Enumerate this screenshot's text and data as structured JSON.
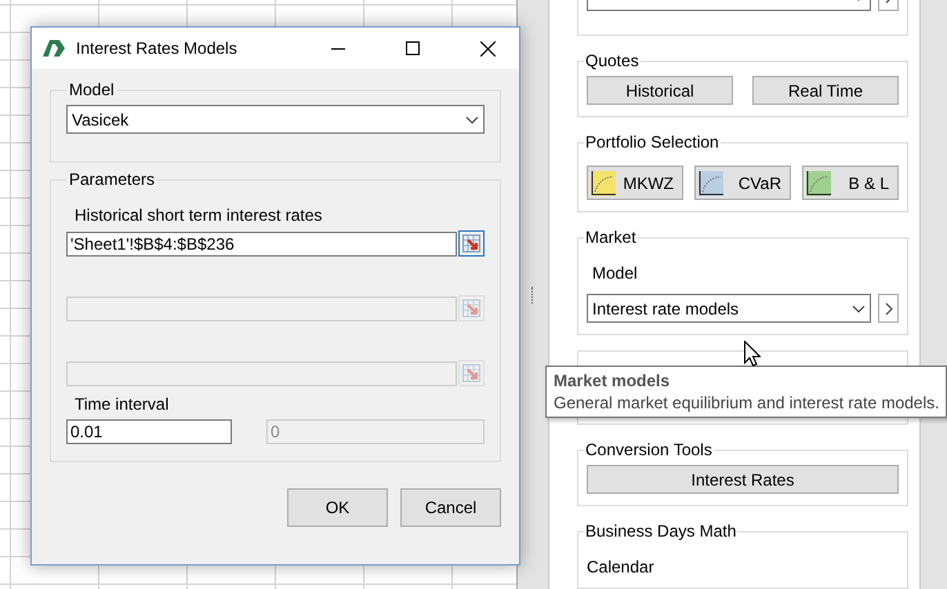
{
  "dialog": {
    "title": "Interest Rates Models",
    "model_group": {
      "label": "Model",
      "value": "Vasicek"
    },
    "parameters_group": {
      "label": "Parameters",
      "range_fields": [
        {
          "label": "Historical short term interest rates",
          "value": "'Sheet1'!$B$4:$B$236",
          "disabled": false
        },
        {
          "disabled": true
        },
        {
          "disabled": true
        }
      ],
      "time_interval": {
        "label": "Time interval",
        "value": "0.01",
        "extra_value": "0"
      }
    },
    "buttons": [
      "OK",
      "Cancel"
    ]
  },
  "panel": {
    "groups": [
      {
        "kind": "combo"
      },
      {
        "kind": "buttons",
        "label": "Quotes",
        "buttons": [
          "Historical",
          "Real Time"
        ]
      },
      {
        "kind": "chart-buttons",
        "label": "Portfolio Selection",
        "buttons": [
          {
            "label": "MKWZ",
            "color": "#f3e36a"
          },
          {
            "label": "CVaR",
            "color": "#b9cde3"
          },
          {
            "label": "B & L",
            "color": "#9fd08f"
          }
        ]
      },
      {
        "kind": "combo",
        "label": "Market",
        "field_label": "Model",
        "value": "Interest rate models"
      },
      {
        "kind": "empty"
      },
      {
        "kind": "buttons",
        "label": "Conversion Tools",
        "buttons": [
          "Interest Rates"
        ]
      },
      {
        "kind": "text",
        "label": "Business Days Math",
        "text": "Calendar"
      }
    ]
  },
  "tooltip": {
    "title": "Market models",
    "text": "General market equilibrium and interest rate models."
  }
}
